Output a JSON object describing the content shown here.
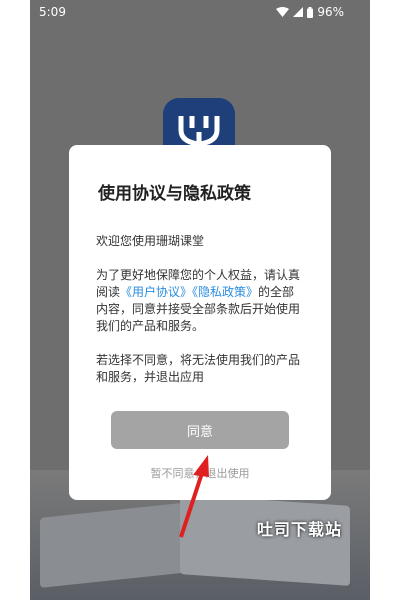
{
  "status_bar": {
    "time": "5:09",
    "battery": "96%"
  },
  "dialog": {
    "title": "使用协议与隐私政策",
    "welcome": "欢迎您使用珊瑚课堂",
    "policy_prefix": "为了更好地保障您的个人权益，请认真阅读",
    "user_agreement_link": "《用户协议》",
    "privacy_policy_link": "《隐私政策》",
    "policy_suffix": "的全部内容，同意并接受全部条款后开始使用我们的产品和服务。",
    "disagree_notice": "若选择不同意，将无法使用我们的产品和服务，并退出应用",
    "agree_button": "同意",
    "disagree_link": "暂不同意，退出使用"
  },
  "watermark": "吐司下载站",
  "colors": {
    "link": "#2a8de0",
    "button_bg": "#a4a4a4",
    "overlay": "#6e6e6e",
    "logo_bg": "#1f3f7a",
    "arrow": "#e02020"
  }
}
